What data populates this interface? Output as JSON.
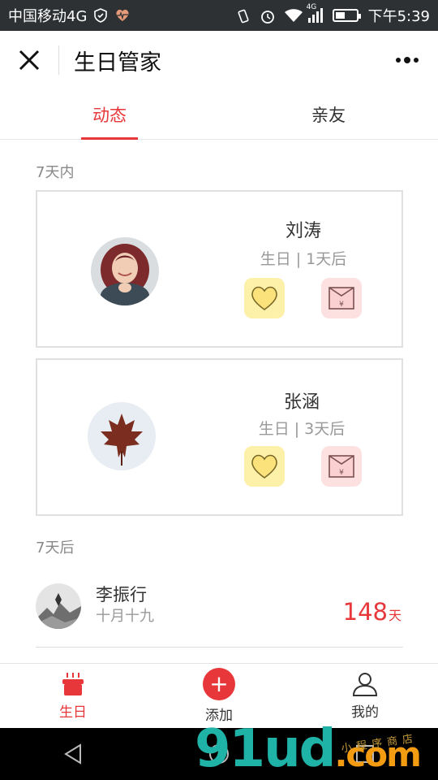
{
  "status_bar": {
    "carrier": "中国移动4G",
    "network_small": "4G",
    "time": "下午5:39"
  },
  "header": {
    "title": "生日管家"
  },
  "tabs": [
    {
      "label": "动态",
      "active": true
    },
    {
      "label": "亲友",
      "active": false
    }
  ],
  "sections": {
    "within_7_days": "7天内",
    "after_7_days": "7天后"
  },
  "cards": [
    {
      "name": "刘涛",
      "sub": "生日 | 1天后",
      "avatar": "woman-portrait"
    },
    {
      "name": "张涵",
      "sub": "生日 | 3天后",
      "avatar": "maple-leaf"
    }
  ],
  "list": [
    {
      "name": "李振行",
      "date": "十月十九",
      "days": "148",
      "days_unit": "天",
      "avatar": "mountain-ink"
    }
  ],
  "tabbar": [
    {
      "label": "生日",
      "icon": "birthday-cake-icon",
      "active": true
    },
    {
      "label": "添加",
      "icon": "plus-circle-icon",
      "active": false
    },
    {
      "label": "我的",
      "icon": "user-icon",
      "active": false
    }
  ],
  "watermark": {
    "main": "91ud",
    "suffix": ".com",
    "sub": "小程序商店"
  },
  "colors": {
    "accent": "#e8373a",
    "heart_bg": "#fdf0a9",
    "money_bg": "#fde1e1",
    "status_bg": "#2e3133"
  }
}
